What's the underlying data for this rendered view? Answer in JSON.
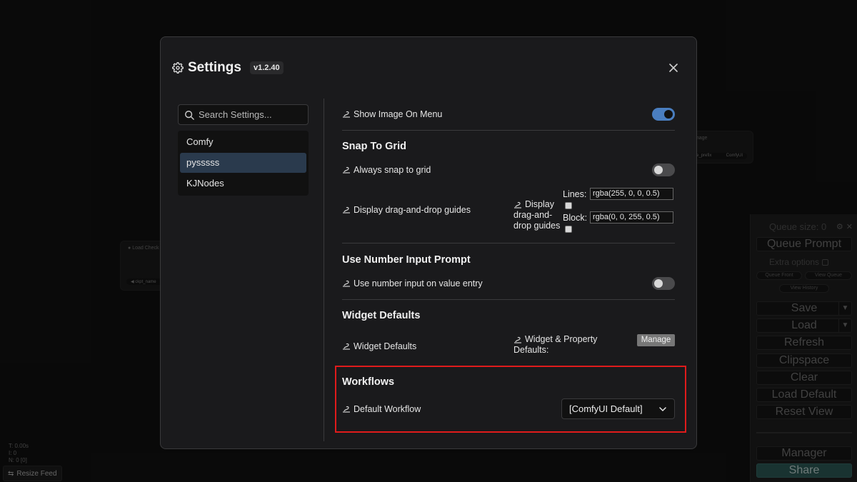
{
  "background": {
    "node_load_title": "Load Check",
    "node_load_widget": "ckpt_name",
    "node_image_title": "Image",
    "node_image_widget_label": "e_prefix",
    "node_image_widget_value": "ComfyUI",
    "stats": [
      "T: 0.00s",
      "I: 0",
      "N: 0 [0]"
    ],
    "resize_feed": "Resize Feed"
  },
  "queue_panel": {
    "queue_size": "Queue size: 0",
    "queue_prompt": "Queue Prompt",
    "extra_options": "Extra options",
    "queue_front": "Queue Front",
    "view_queue": "View Queue",
    "view_history": "View History",
    "save": "Save",
    "load": "Load",
    "refresh": "Refresh",
    "clipspace": "Clipspace",
    "clear": "Clear",
    "load_default": "Load Default",
    "reset_view": "Reset View",
    "manager": "Manager",
    "share": "Share",
    "caret": "▼"
  },
  "dialog": {
    "title": "Settings",
    "version": "v1.2.40",
    "search_placeholder": "Search Settings...",
    "categories": [
      {
        "label": "Comfy",
        "active": false
      },
      {
        "label": "pysssss",
        "active": true
      },
      {
        "label": "KJNodes",
        "active": false
      }
    ],
    "settings": {
      "show_image_on_menu": {
        "label": "Show Image On Menu",
        "enabled": true
      },
      "snap_to_grid": {
        "section": "Snap To Grid",
        "always_snap": {
          "label": "Always snap to grid",
          "enabled": false
        },
        "drag_drop_guides": {
          "label": "Display drag-and-drop guides",
          "sub_label_line1": "Display",
          "sub_label_line2": "drag-and-",
          "sub_label_line3": "drop guides",
          "lines_label": "Lines:",
          "lines_value": "rgba(255, 0, 0, 0.5)",
          "block_label": "Block:",
          "block_value": "rgba(0, 0, 255, 0.5)"
        }
      },
      "number_input": {
        "section": "Use Number Input Prompt",
        "label": "Use number input on value entry",
        "enabled": false
      },
      "widget_defaults": {
        "section": "Widget Defaults",
        "label": "Widget Defaults",
        "sub_label_line1": "Widget & Property",
        "sub_label_line2": "Defaults:",
        "manage": "Manage"
      },
      "workflows": {
        "section": "Workflows",
        "label": "Default Workflow",
        "value": "[ComfyUI Default]"
      }
    }
  },
  "colors": {
    "toggle_on": "#4a7ec0",
    "highlight": "#e01b1b",
    "active_category": "#2a3a4d",
    "share": "#2e5d5a"
  }
}
